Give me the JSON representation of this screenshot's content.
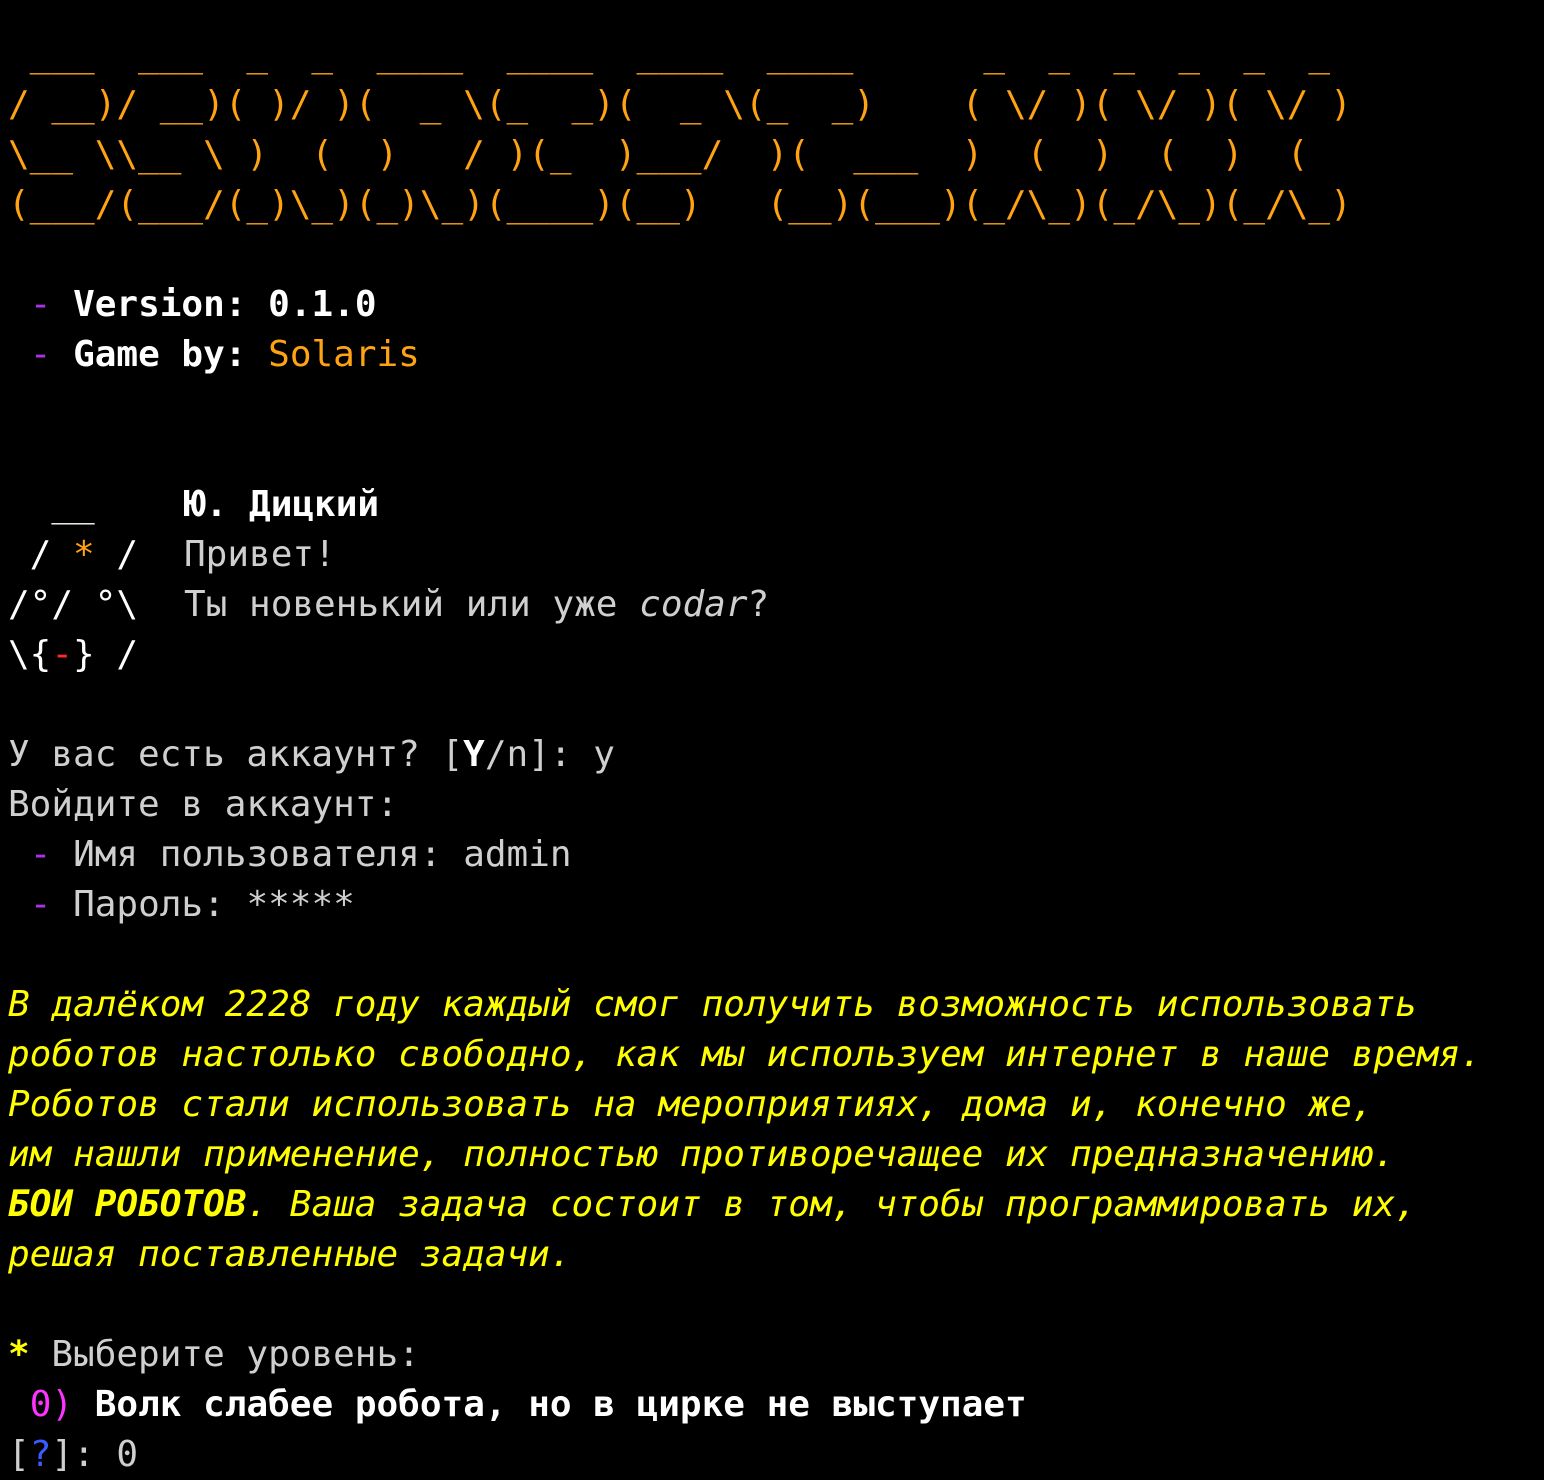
{
  "colors": {
    "background": "#000000",
    "banner": "#ffa313",
    "bullet": "#a833e8",
    "story": "#ffff00",
    "option_number": "#ff33ff",
    "prompt_mark": "#3b5bff",
    "mouth": "#ff2a2a"
  },
  "banner": [
    " ___  ___  _  _  ____  ____  ____  ____      _  _  _  _  _  _",
    "/ __)/ __)( )/ )(  _ \\(_  _)(  _ \\(_  _)    ( \\/ )( \\/ )( \\/ )",
    "\\__ \\\\__ \\ )  (  )   / )(_  )___/  )(  ___  )  (  )  (  )  (",
    "(___/(___/(_)\\_)(_)\\_)(____)(__)   (__)(___)(_/\\_)(_/\\_)(_/\\_)"
  ],
  "info": {
    "version_label": "Version: ",
    "version_value": "0.1.0",
    "author_label": "Game by: ",
    "author_value": "Solaris",
    "bullet": "-"
  },
  "character": {
    "art_line1": "  __",
    "art_line2_a": " / ",
    "art_line2_star": "*",
    "art_line2_b": " /",
    "art_line3": "/°/ °\\",
    "art_line4_a": "\\{",
    "art_line4_mouth": "-",
    "art_line4_b": "} /",
    "name": "Ю. Дицкий",
    "greeting": "Привет!",
    "question_text": "Ты новенький или уже ",
    "question_word": "codar",
    "question_end": "?"
  },
  "login": {
    "account_prompt_a": "У вас есть аккаунт? [",
    "account_prompt_default": "Y",
    "account_prompt_b": "/n]: ",
    "account_answer": "y",
    "login_header": "Войдите в аккаунт:",
    "username_label": "Имя пользователя: ",
    "username_value": "admin",
    "password_label": "Пароль: ",
    "password_value": "*****"
  },
  "story": {
    "line1": "В далёком 2228 году каждый смог получить возможность использовать",
    "line2": "роботов настолько свободно, как мы используем интернет в наше время.",
    "line3": "Роботов стали использовать на мероприятиях, дома и, конечно же,",
    "line4": "им нашли применение, полностью противоречащее их предназначению.",
    "line5_bold": "БОИ РОБОТОВ",
    "line5_rest": ". Ваша задача состоит в том, чтобы программировать их,",
    "line6": "решая поставленные задачи."
  },
  "levels": {
    "select_mark": "*",
    "select_label": " Выберите уровень:",
    "options": [
      {
        "number": "0)",
        "label": "Волк слабее робота, но в цирке не выступает"
      }
    ],
    "prompt_open": "[",
    "prompt_mark": "?",
    "prompt_close": "]: ",
    "input_value": "0"
  }
}
